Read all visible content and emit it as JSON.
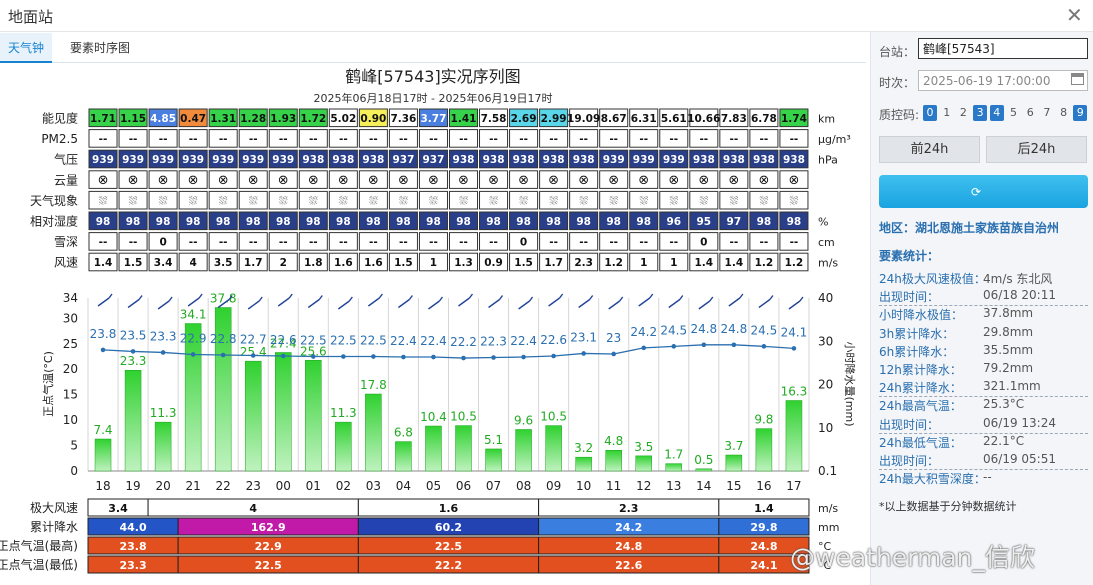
{
  "window": {
    "title": "地面站",
    "close_icon": "close-icon"
  },
  "tabs": [
    {
      "label": "天气钟",
      "active": true
    },
    {
      "label": "要素时序图",
      "active": false
    }
  ],
  "chart_data": {
    "type": "table",
    "title": "鹤峰[57543]实况序列图",
    "subtitle": "2025年06月18日17时 - 2025年06月19日17时",
    "hours": [
      "18",
      "19",
      "20",
      "21",
      "22",
      "23",
      "00",
      "01",
      "02",
      "03",
      "04",
      "05",
      "06",
      "07",
      "08",
      "09",
      "10",
      "11",
      "12",
      "13",
      "14",
      "15",
      "16",
      "17"
    ],
    "rows": [
      {
        "label": "能见度",
        "unit": "km",
        "kind": "visibility",
        "values": [
          "1.71",
          "1.15",
          "4.85",
          "0.47",
          "1.31",
          "1.28",
          "1.93",
          "1.72",
          "5.02",
          "0.90",
          "7.36",
          "3.77",
          "1.41",
          "7.58",
          "2.69",
          "2.99",
          "19.09",
          "8.67",
          "6.31",
          "5.61",
          "10.66",
          "7.83",
          "6.78",
          "1.74"
        ]
      },
      {
        "label": "PM2.5",
        "unit": "μg/m³",
        "kind": "plain",
        "values": [
          "--",
          "--",
          "--",
          "--",
          "--",
          "--",
          "--",
          "--",
          "--",
          "--",
          "--",
          "--",
          "--",
          "--",
          "--",
          "--",
          "--",
          "--",
          "--",
          "--",
          "--",
          "--",
          "--",
          "--"
        ]
      },
      {
        "label": "气压",
        "unit": "hPa",
        "kind": "dark",
        "values": [
          "939",
          "939",
          "939",
          "939",
          "939",
          "939",
          "939",
          "938",
          "938",
          "938",
          "937",
          "937",
          "938",
          "938",
          "938",
          "938",
          "938",
          "939",
          "939",
          "939",
          "938",
          "938",
          "938",
          "938"
        ]
      },
      {
        "label": "云量",
        "unit": "",
        "kind": "symbol",
        "symbol": "⊗",
        "values": [
          "⊗",
          "⊗",
          "⊗",
          "⊗",
          "⊗",
          "⊗",
          "⊗",
          "⊗",
          "⊗",
          "⊗",
          "⊗",
          "⊗",
          "⊗",
          "⊗",
          "⊗",
          "⊗",
          "⊗",
          "⊗",
          "⊗",
          "⊗",
          "⊗",
          "⊗",
          "⊗",
          "⊗"
        ]
      },
      {
        "label": "天气现象",
        "unit": "",
        "kind": "weather",
        "symbol": "rain-shower-icon",
        "values": [
          "",
          "",
          "",
          "",
          "",
          "",
          "",
          "",
          "",
          "",
          "",
          "",
          "",
          "",
          "",
          "",
          "",
          "",
          "",
          "",
          "",
          "",
          "",
          ""
        ]
      },
      {
        "label": "相对湿度",
        "unit": "%",
        "kind": "dark",
        "values": [
          "98",
          "98",
          "98",
          "98",
          "98",
          "98",
          "98",
          "98",
          "98",
          "98",
          "98",
          "98",
          "98",
          "98",
          "98",
          "98",
          "98",
          "98",
          "98",
          "96",
          "95",
          "97",
          "98",
          "98"
        ]
      },
      {
        "label": "雪深",
        "unit": "cm",
        "kind": "plain",
        "values": [
          "--",
          "--",
          "0",
          "--",
          "--",
          "--",
          "--",
          "--",
          "--",
          "--",
          "--",
          "--",
          "--",
          "--",
          "0",
          "--",
          "--",
          "--",
          "--",
          "--",
          "0",
          "--",
          "--",
          "--"
        ]
      },
      {
        "label": "风速",
        "unit": "m/s",
        "kind": "plain",
        "values": [
          "1.4",
          "1.5",
          "3.4",
          "4",
          "3.5",
          "1.7",
          "2",
          "1.8",
          "1.6",
          "1.6",
          "1.5",
          "1",
          "1.3",
          "0.9",
          "1.5",
          "1.7",
          "2.3",
          "1.2",
          "1",
          "1",
          "1.4",
          "1.4",
          "1.2",
          "1.2"
        ]
      }
    ],
    "combo": {
      "left_axis": {
        "label": "正点气温(°C)",
        "ticks": [
          0,
          5,
          10,
          15,
          20,
          25,
          30,
          34
        ],
        "ylim": [
          0,
          34
        ]
      },
      "right_axis": {
        "label": "小时降水量(mm)",
        "ticks": [
          "0.1",
          "10",
          "20",
          "30",
          "40"
        ],
        "ylim": [
          0,
          40
        ]
      },
      "temperature": [
        23.8,
        23.5,
        23.3,
        22.9,
        22.8,
        22.7,
        22.6,
        22.5,
        22.5,
        22.5,
        22.4,
        22.4,
        22.2,
        22.3,
        22.4,
        22.6,
        23.1,
        23,
        24.2,
        24.5,
        24.8,
        24.8,
        24.5,
        24.1
      ],
      "temperature_labels": [
        "23.8",
        "23.5",
        "23.3",
        "22.9",
        "22.8",
        "22.7",
        "22.6",
        "22.5",
        "22.5",
        "22.5",
        "22.4",
        "22.4",
        "22.2",
        "22.3",
        "22.4",
        "22.6",
        "23.1",
        "23",
        "24.2",
        "24.5",
        "24.8",
        "24.8",
        "24.5",
        "24.1"
      ],
      "precipitation": [
        7.4,
        23.3,
        11.3,
        34.1,
        37.8,
        25.4,
        27.4,
        25.6,
        11.3,
        17.8,
        6.8,
        10.4,
        10.5,
        5.1,
        9.6,
        10.5,
        3.2,
        4.8,
        3.5,
        1.7,
        0.5,
        3.7,
        9.8,
        16.3
      ],
      "precipitation_labels": [
        "7.4",
        "23.3",
        "11.3",
        "34.1",
        "37.8",
        "25.4",
        "27.4",
        "25.6",
        "11.3",
        "17.8",
        "6.8",
        "10.4",
        "10.5",
        "5.1",
        "9.6",
        "10.5",
        "3.2",
        "4.8",
        "3.5",
        "1.7",
        "0.5",
        "3.7",
        "9.8",
        "16.3"
      ]
    },
    "summary": {
      "units": [
        "m/s",
        "mm",
        "°C",
        "°C"
      ],
      "rows": [
        {
          "label": "极大风速",
          "kind": "plain",
          "cells": [
            {
              "span": [
                0,
                2
              ],
              "value": "3.4"
            },
            {
              "span": [
                2,
                9
              ],
              "value": "4"
            },
            {
              "span": [
                9,
                15
              ],
              "value": "1.6"
            },
            {
              "span": [
                15,
                21
              ],
              "value": "2.3"
            },
            {
              "span": [
                21,
                24
              ],
              "value": "1.4"
            }
          ]
        },
        {
          "label": "累计降水",
          "kind": "precip",
          "cells": [
            {
              "span": [
                0,
                3
              ],
              "value": "44.0",
              "color": "#2455c7"
            },
            {
              "span": [
                3,
                9
              ],
              "value": "162.9",
              "color": "#c11aa8"
            },
            {
              "span": [
                9,
                15
              ],
              "value": "60.2",
              "color": "#2443b3"
            },
            {
              "span": [
                15,
                21
              ],
              "value": "24.2",
              "color": "#3a7fe0"
            },
            {
              "span": [
                21,
                24
              ],
              "value": "29.8",
              "color": "#2f6fd6"
            }
          ]
        },
        {
          "label": "正点气温(最高)",
          "kind": "temp",
          "cells": [
            {
              "span": [
                0,
                3
              ],
              "value": "23.8"
            },
            {
              "span": [
                3,
                9
              ],
              "value": "22.9"
            },
            {
              "span": [
                9,
                15
              ],
              "value": "22.5"
            },
            {
              "span": [
                15,
                21
              ],
              "value": "24.8"
            },
            {
              "span": [
                21,
                24
              ],
              "value": "24.8"
            }
          ]
        },
        {
          "label": "正点气温(最低)",
          "kind": "temp",
          "cells": [
            {
              "span": [
                0,
                3
              ],
              "value": "23.3"
            },
            {
              "span": [
                3,
                9
              ],
              "value": "22.5"
            },
            {
              "span": [
                9,
                15
              ],
              "value": "22.2"
            },
            {
              "span": [
                15,
                21
              ],
              "value": "22.6"
            },
            {
              "span": [
                21,
                24
              ],
              "value": "24.1"
            }
          ]
        }
      ]
    }
  },
  "colors": {
    "pressure_bg": "#2a3f8a",
    "humidity_bg": "#2a3f8a",
    "bar_green": "#22bb22",
    "temp_line": "#2a6fb0",
    "summary_red": "#e3501f",
    "accent": "#1684d0"
  },
  "sidebar": {
    "station_label": "台站：",
    "station_value": "鹤峰[57543]",
    "time_label": "时次：",
    "time_value": "2025-06-19 17:00:00",
    "qc_label": "质控码:",
    "qc_codes": [
      {
        "code": "0",
        "on": true
      },
      {
        "code": "1",
        "on": false
      },
      {
        "code": "2",
        "on": false
      },
      {
        "code": "3",
        "on": true
      },
      {
        "code": "4",
        "on": true
      },
      {
        "code": "5",
        "on": false
      },
      {
        "code": "6",
        "on": false
      },
      {
        "code": "7",
        "on": false
      },
      {
        "code": "8",
        "on": false
      },
      {
        "code": "9",
        "on": true
      }
    ],
    "prev_label": "前24h",
    "next_label": "后24h",
    "query_icon": "refresh-icon",
    "region": "地区：湖北恩施土家族苗族自治州",
    "stats_title": "要素统计：",
    "stats": [
      {
        "k": "24h极大风速极值：",
        "v": "4m/s 东北风"
      },
      {
        "k": "出现时间：",
        "v": "06/18 20:11"
      },
      {
        "k": "小时降水极值：",
        "v": "37.8mm"
      },
      {
        "k": "3h累计降水：",
        "v": "29.8mm"
      },
      {
        "k": "6h累计降水：",
        "v": "35.5mm"
      },
      {
        "k": "12h累计降水：",
        "v": "79.2mm"
      },
      {
        "k": "24h累计降水：",
        "v": "321.1mm"
      },
      {
        "k": "24h最高气温：",
        "v": "25.3°C"
      },
      {
        "k": "出现时间：",
        "v": "06/19 13:24"
      },
      {
        "k": "24h最低气温：",
        "v": "22.1°C"
      },
      {
        "k": "出现时间：",
        "v": "06/19 05:51"
      },
      {
        "k": "24h最大积雪深度：",
        "v": "--"
      }
    ],
    "note": "*以上数据基于分钟数据统计"
  },
  "watermark": "@weatherman_信欣"
}
